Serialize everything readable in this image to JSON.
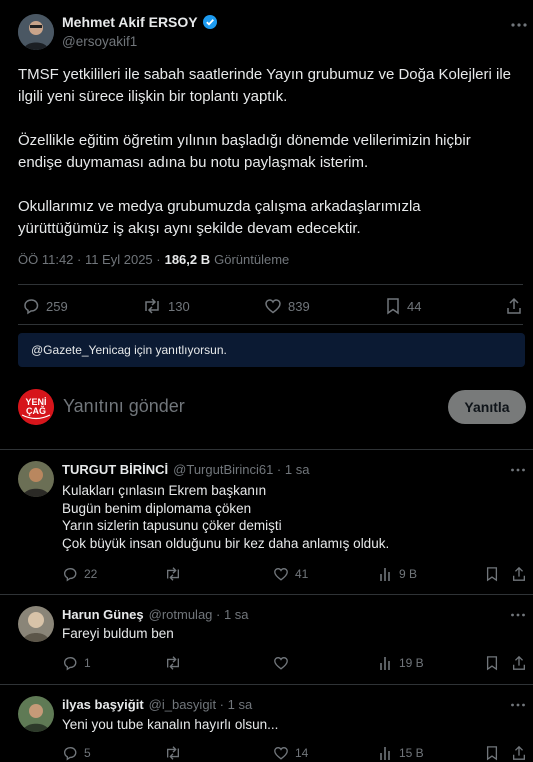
{
  "tweet": {
    "author_name": "Mehmet Akif ERSOY",
    "author_handle": "@ersoyakif1",
    "paragraphs": [
      [
        "TMSF yetkilileri ile sabah saatlerinde Yayın grubumuz ve Doğa Kolejleri ile",
        "ilgili yeni sürece ilişkin bir toplantı yaptık."
      ],
      [
        "Özellikle eğitim öğretim yılının başladığı dönemde velilerimizin hiçbir",
        "endişe duymaması adına bu notu paylaşmak isterim."
      ],
      [
        "Okullarımız ve medya grubumuzda çalışma arkadaşlarımızla",
        "yürüttüğümüz iş akışı aynı şekilde devam edecektir."
      ]
    ],
    "time": "ÖÖ 11:42 · 11 Eyl 2025 ·",
    "views_value": "186,2 B",
    "views_label": "Görüntüleme",
    "replies": "259",
    "retweets": "130",
    "likes": "839",
    "bookmarks": "44"
  },
  "replying_to": "@Gazete_Yenicag için yanıtlıyorsun.",
  "composer": {
    "avatar_text_top": "YENİ",
    "avatar_text_bottom": "ÇAĞ",
    "placeholder": "Yanıtını gönder",
    "reply_button": "Yanıtla"
  },
  "replies": [
    {
      "name": "TURGUT BİRİNCİ",
      "meta": "@TurgutBirinci61 · 1 sa",
      "lines": [
        "Kulakları çınlasın Ekrem başkanın",
        "Bugün benim diplomama çöken",
        "Yarın sizlerin tapusunu çöker demişti",
        "Çok büyük insan olduğunu bir kez daha anlamış olduk."
      ],
      "reply_count": "22",
      "retweet_count": "",
      "like_count": "41",
      "views": "9 B"
    },
    {
      "name": "Harun Güneş",
      "meta": "@rotmulag · 1 sa",
      "lines": [
        "Fareyi buldum ben"
      ],
      "reply_count": "1",
      "retweet_count": "",
      "like_count": "",
      "views": "19 B"
    },
    {
      "name": "ilyas başyiğit",
      "meta": "@i_basyigit · 1 sa",
      "lines": [
        "Yeni you tube kanalın hayırlı olsun..."
      ],
      "reply_count": "5",
      "retweet_count": "",
      "like_count": "14",
      "views": "15 B"
    }
  ],
  "colors": {
    "accent": "#1d9bf0",
    "muted": "#71767b",
    "banner_bg": "#0b1a33",
    "button_bg": "#787a7a"
  }
}
